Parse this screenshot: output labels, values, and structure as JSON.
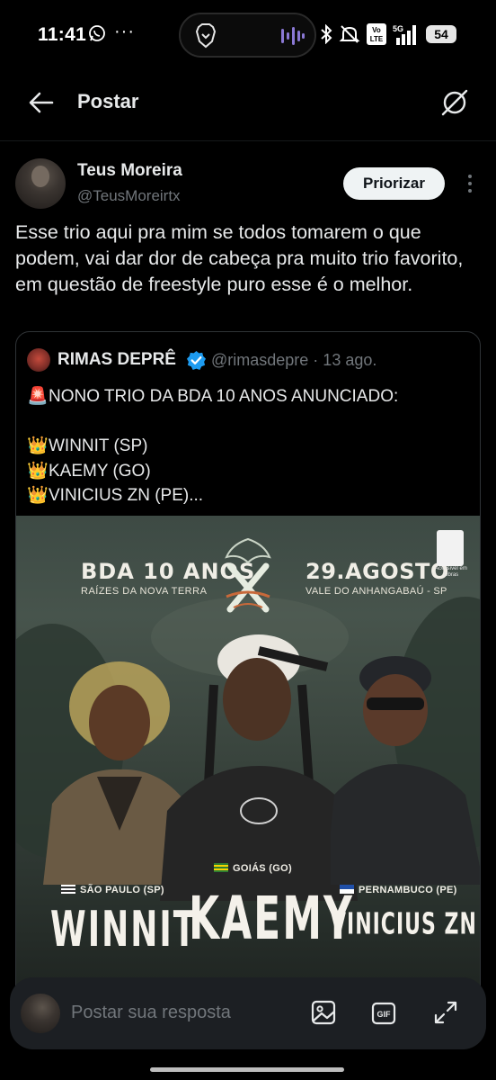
{
  "status_bar": {
    "time": "11:41",
    "more": "···",
    "battery": "54",
    "volte": "Vo LTE",
    "network": "5G"
  },
  "header": {
    "title": "Postar"
  },
  "post": {
    "author_name": "Teus Moreira",
    "author_handle": "@TeusMoreirtx",
    "prioritize_label": "Priorizar",
    "text": "Esse trio aqui pra mim se todos tomarem o que podem, vai dar dor de cabeça pra muito trio favorito, em questão de freestyle puro esse é o melhor."
  },
  "quote": {
    "name": "RIMAS DEPRÊ",
    "handle_time": "@rimasdepre · 13 ago.",
    "lines": [
      {
        "emoji": "🚨",
        "text": "NONO TRIO DA BDA 10 ANOS ANUNCIADO:"
      },
      {
        "emoji": "",
        "text": ""
      },
      {
        "emoji": "👑",
        "text": "WINNIT (SP)"
      },
      {
        "emoji": "👑",
        "text": "KAEMY (GO)"
      },
      {
        "emoji": "👑",
        "text": "VINICIUS ZN (PE)..."
      }
    ],
    "poster": {
      "event": "BDA 10 ANOS",
      "subtitle": "RAÍZES DA NOVA TERRA",
      "date": "29.AGOSTO",
      "venue": "VALE DO ANHANGABAÚ - SP",
      "accessibility": "Acessível em Libras",
      "artists": [
        {
          "state": "SÃO PAULO (SP)",
          "name": "WINNIT"
        },
        {
          "state": "GOIÁS (GO)",
          "name": "KAEMY"
        },
        {
          "state": "PERNAMBUCO (PE)",
          "name": "VINICIUS ZN"
        }
      ]
    }
  },
  "reply": {
    "placeholder": "Postar sua resposta",
    "gif_label": "GIF"
  },
  "colors": {
    "background": "#000000",
    "text_primary": "#e7e9ea",
    "text_secondary": "#71767b",
    "verified": "#1d9bf0",
    "reply_bar": "#1c1f23",
    "border": "#2f3336"
  },
  "icons": [
    "whatsapp-icon",
    "brave-icon",
    "audio-bars-icon",
    "bluetooth-icon",
    "mute-icon",
    "signal-icon",
    "back-arrow-icon",
    "grok-icon",
    "more-vertical-icon",
    "verified-badge-icon",
    "image-icon",
    "gif-icon",
    "expand-icon"
  ]
}
